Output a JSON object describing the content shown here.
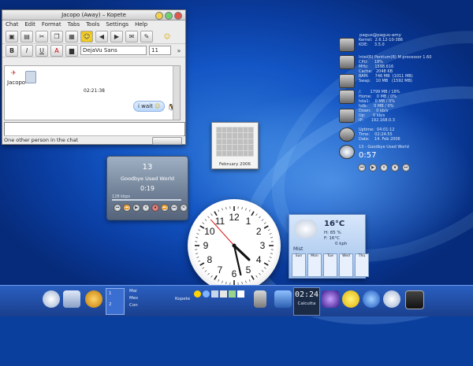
{
  "kopete": {
    "title": "Jacopo (Away) – Kopete",
    "menu": [
      "Chat",
      "Edit",
      "Format",
      "Tabs",
      "Tools",
      "Settings",
      "Help"
    ],
    "font_name": "DejaVu Sans",
    "font_size": "11",
    "contact_name": "Jacopo",
    "message_time": "02:21:38",
    "message_text": "i wait",
    "status_text": "One other person in the chat"
  },
  "calendar_frame": {
    "caption": "February 2006"
  },
  "amarok": {
    "track_number": "13",
    "song_title": "Goodbye Used World",
    "elapsed": "0:19",
    "bitrate": "128 kbps",
    "controls": [
      "⏮",
      "⏪",
      "▶",
      "⏸",
      "⏹",
      "⏩",
      "⏭",
      "✕"
    ]
  },
  "clock": {
    "hour": 4,
    "minute": 27,
    "second": 53
  },
  "sysmon": {
    "user_host": "pagus@pagus-amy",
    "rows": [
      {
        "icon": "tux-icon",
        "text": "Kernel:  2.6.12-10-386\nKDE:     3.5.0"
      },
      {
        "icon": "cpu-icon",
        "text": "Intel(R) Pentium(R) M processor 1.60\nCPU:     18%\nMHz:     1598.616\nCache:   2048 KB"
      },
      {
        "icon": "memory-icon",
        "text": "RAM:     746 MB  (1011 MB)\nSwap:    10 MB   (1592 MB)"
      },
      {
        "icon": "disk-icon",
        "text": "/:       1799 MB / 18%\nHome:    0 MB / 0%\nhda1:    0 MB / 0%\nhdb:     0 MB / 0%"
      },
      {
        "icon": "network-icon",
        "text": "Down:    0 kb/s\nUp:      0 kb/s\nIP:      192.168.0.3"
      },
      {
        "icon": "clock-icon",
        "text": "Uptime:  04:01:12\nTime:    02:24:55\nDate:    14. Feb 2006"
      }
    ],
    "player_title": "13 - Goodbye Used World",
    "player_time": "0:57"
  },
  "weather": {
    "temperature": "16°C",
    "humidity": "H: 85 %",
    "feels_like": "F: 16°C",
    "wind": "0 kph",
    "condition": "Mist",
    "days": [
      "Sun",
      "Mon",
      "Tue",
      "Wed",
      "Thu"
    ]
  },
  "taskbar": {
    "clock_time": "02:24",
    "clock_city": "Calcutta",
    "kopete_label": "Kopete",
    "desktop_numbers": [
      "1",
      "2"
    ],
    "items": [
      "Mai",
      "Mes",
      "Con"
    ]
  },
  "colors": {
    "desktop_blue": "#1355c4",
    "bubble_blue": "#b9d6fa",
    "taskbar_blue": "#1a3f8d"
  }
}
